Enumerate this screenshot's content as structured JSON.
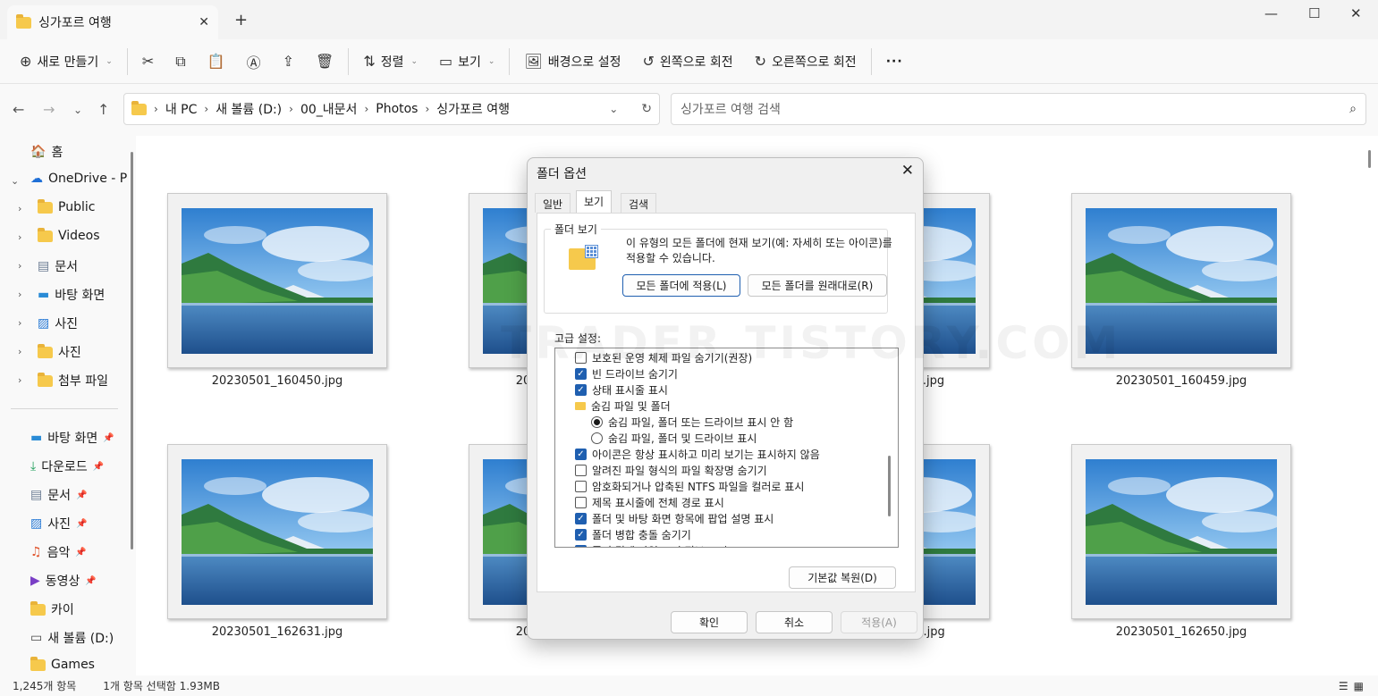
{
  "window": {
    "tab_title": "싱가포르 여행",
    "tab_close": "✕",
    "new_tab": "+",
    "minimize": "—",
    "maximize": "☐",
    "close": "✕"
  },
  "toolbar": {
    "new_label": "새로 만들기",
    "sort_label": "정렬",
    "view_label": "보기",
    "set_background": "배경으로 설정",
    "rotate_left": "왼쪽으로 회전",
    "rotate_right": "오른쪽으로 회전",
    "more": "···"
  },
  "nav": {
    "breadcrumb": [
      "내 PC",
      "새 볼륨 (D:)",
      "00_내문서",
      "Photos",
      "싱가포르 여행"
    ],
    "search_placeholder": "싱가포르 여행 검색"
  },
  "sidebar": {
    "tree": [
      {
        "label": "홈",
        "icon": "home-icon"
      },
      {
        "label": "OneDrive - Pe",
        "icon": "onedrive-icon"
      },
      {
        "label": "Public",
        "icon": "folder-icon"
      },
      {
        "label": "Videos",
        "icon": "folder-icon"
      },
      {
        "label": "문서",
        "icon": "documents-icon"
      },
      {
        "label": "바탕 화면",
        "icon": "desktop-icon"
      },
      {
        "label": "사진",
        "icon": "pictures-icon"
      },
      {
        "label": "사진",
        "icon": "folder-icon"
      },
      {
        "label": "첨부 파일",
        "icon": "folder-icon"
      }
    ],
    "quick": [
      {
        "label": "바탕 화면",
        "icon": "desktop-icon",
        "pinned": true
      },
      {
        "label": "다운로드",
        "icon": "download-icon",
        "pinned": true
      },
      {
        "label": "문서",
        "icon": "documents-icon",
        "pinned": true
      },
      {
        "label": "사진",
        "icon": "pictures-icon",
        "pinned": true
      },
      {
        "label": "음악",
        "icon": "music-icon",
        "pinned": true
      },
      {
        "label": "동영상",
        "icon": "video-icon",
        "pinned": true
      },
      {
        "label": "카이",
        "icon": "folder-icon",
        "pinned": false
      },
      {
        "label": "새 볼륨 (D:)",
        "icon": "drive-icon",
        "pinned": false
      },
      {
        "label": "Games",
        "icon": "folder-icon",
        "pinned": false
      }
    ]
  },
  "files": {
    "row1": [
      "20230501_160450.jpg",
      "20",
      ".jpg",
      "20230501_160459.jpg"
    ],
    "row2": [
      "20230501_162631.jpg",
      "20",
      "0).jpg",
      "20230501_162650.jpg"
    ]
  },
  "status": {
    "count": "1,245개 항목",
    "selection": "1개 항목 선택함 1.93MB"
  },
  "dialog": {
    "title": "폴더 옵션",
    "tabs": [
      "일반",
      "보기",
      "검색"
    ],
    "active_tab": "보기",
    "group_title": "폴더 보기",
    "description": "이 유형의 모든 폴더에 현재 보기(예: 자세히 또는 아이콘)를 적용할 수 있습니다.",
    "apply_all": "모든 폴더에 적용(L)",
    "reset_all": "모든 폴더를 원래대로(R)",
    "advanced_label": "고급 설정:",
    "settings": [
      {
        "type": "checkbox",
        "checked": false,
        "indent": 0,
        "label": "보호된 운영 체제 파일 숨기기(권장)"
      },
      {
        "type": "checkbox",
        "checked": true,
        "indent": 0,
        "label": "빈 드라이브 숨기기"
      },
      {
        "type": "checkbox",
        "checked": true,
        "indent": 0,
        "label": "상태 표시줄 표시"
      },
      {
        "type": "folder",
        "checked": false,
        "indent": 0,
        "label": "숨김 파일 및 폴더"
      },
      {
        "type": "radio",
        "checked": true,
        "indent": 1,
        "label": "숨김 파일, 폴더 또는 드라이브 표시 안 함"
      },
      {
        "type": "radio",
        "checked": false,
        "indent": 1,
        "label": "숨김 파일, 폴더 및 드라이브 표시"
      },
      {
        "type": "checkbox",
        "checked": true,
        "indent": 0,
        "label": "아이콘은 항상 표시하고 미리 보기는 표시하지 않음"
      },
      {
        "type": "checkbox",
        "checked": false,
        "indent": 0,
        "label": "알려진 파일 형식의 파일 확장명 숨기기"
      },
      {
        "type": "checkbox",
        "checked": false,
        "indent": 0,
        "label": "암호화되거나 압축된 NTFS 파일을 컬러로 표시"
      },
      {
        "type": "checkbox",
        "checked": false,
        "indent": 0,
        "label": "제목 표시줄에 전체 경로 표시"
      },
      {
        "type": "checkbox",
        "checked": true,
        "indent": 0,
        "label": "폴더 및 바탕 화면 항목에 팝업 설명 표시"
      },
      {
        "type": "checkbox",
        "checked": true,
        "indent": 0,
        "label": "폴더 병합 충돌 숨기기"
      },
      {
        "type": "checkbox",
        "checked": true,
        "indent": 0,
        "label": "폴더 팁에 파일 크기 정보 표시"
      }
    ],
    "restore_defaults": "기본값 복원(D)",
    "ok": "확인",
    "cancel": "취소",
    "apply": "적용(A)"
  },
  "watermark": "TRADER.TISTORY.COM",
  "colors": {
    "accent": "#1f5fb0",
    "folder": "#f6c94c",
    "chrome": "#f3f3f3"
  }
}
